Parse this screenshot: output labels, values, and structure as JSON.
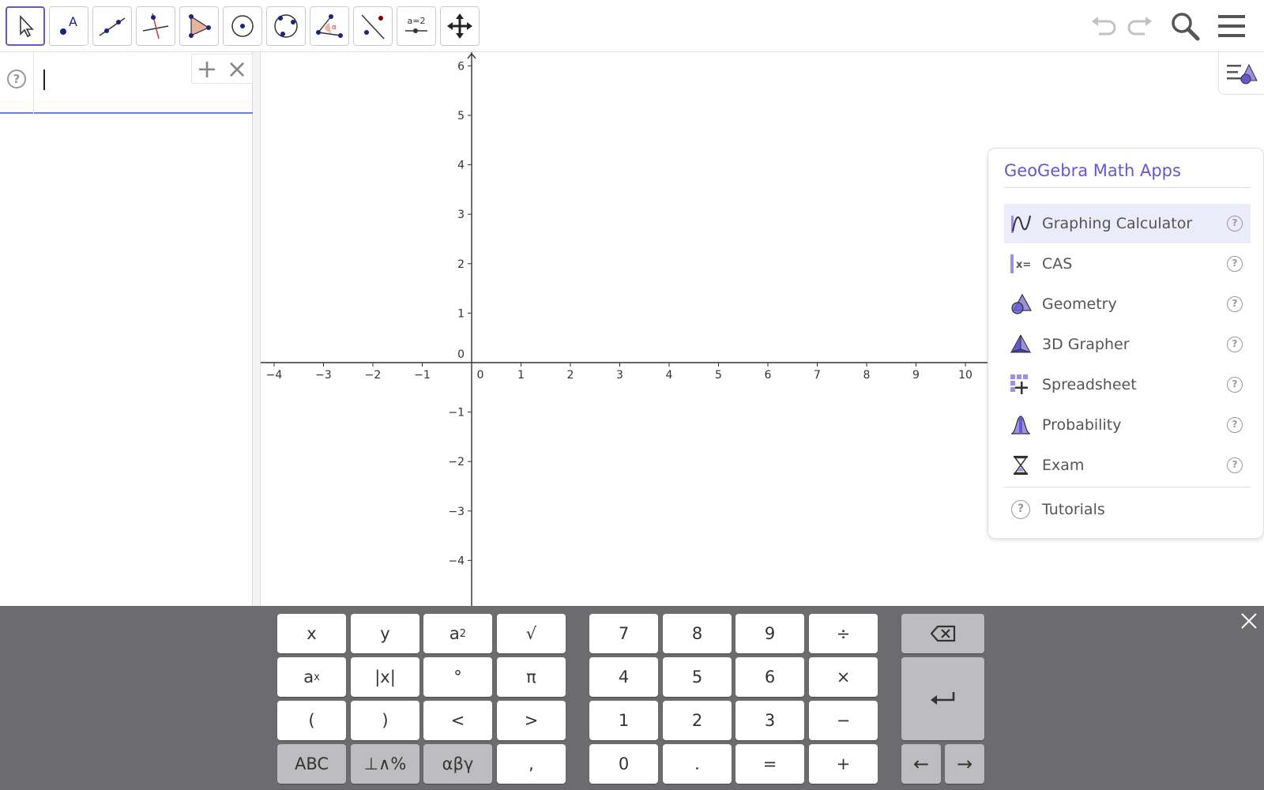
{
  "toolbar": {
    "tools": [
      {
        "name": "move-tool",
        "icon": "cursor-arrow-icon",
        "active": true
      },
      {
        "name": "point-tool",
        "icon": "point-a-icon"
      },
      {
        "name": "line-tool",
        "icon": "line-through-points-icon"
      },
      {
        "name": "perpendicular-line-tool",
        "icon": "perpendicular-line-icon"
      },
      {
        "name": "polygon-tool",
        "icon": "polygon-icon"
      },
      {
        "name": "circle-center-point-tool",
        "icon": "circle-center-icon"
      },
      {
        "name": "circle-three-points-tool",
        "icon": "circle-three-points-icon"
      },
      {
        "name": "angle-tool",
        "icon": "angle-icon"
      },
      {
        "name": "reflect-tool",
        "icon": "reflect-about-line-icon"
      },
      {
        "name": "slider-tool",
        "icon": "slider-icon",
        "label": "a=2"
      },
      {
        "name": "move-graphics-view-tool",
        "icon": "move-arrows-icon"
      }
    ],
    "right": [
      "undo-icon",
      "redo-icon",
      "search-icon",
      "menu-icon"
    ]
  },
  "algebra": {
    "help": "?",
    "input_value": "",
    "add_symbol": "+",
    "close_symbol": "×"
  },
  "graphics": {
    "x_ticks": [
      "−4",
      "−3",
      "−2",
      "−1",
      "0",
      "1",
      "2",
      "3",
      "4",
      "5",
      "6",
      "7",
      "8",
      "9",
      "10"
    ],
    "y_ticks": [
      "6",
      "5",
      "4",
      "3",
      "2",
      "1",
      "0",
      "−1",
      "−2",
      "−3",
      "−4"
    ],
    "origin_x": "0"
  },
  "apps_panel": {
    "title": "GeoGebra Math Apps",
    "apps": [
      {
        "label": "Graphing Calculator",
        "icon": "graphing-icon",
        "selected": true
      },
      {
        "label": "CAS",
        "icon": "cas-icon"
      },
      {
        "label": "Geometry",
        "icon": "geometry-icon"
      },
      {
        "label": "3D Grapher",
        "icon": "3d-grapher-icon"
      },
      {
        "label": "Spreadsheet",
        "icon": "spreadsheet-icon"
      },
      {
        "label": "Probability",
        "icon": "probability-icon"
      },
      {
        "label": "Exam",
        "icon": "hourglass-icon"
      }
    ],
    "tutorials": "Tutorials",
    "help": "?"
  },
  "keyboard": {
    "left": [
      [
        "x",
        "y",
        "a2",
        "√"
      ],
      [
        "ax",
        "|x|",
        "°",
        "π"
      ],
      [
        "(",
        ")",
        "<",
        ">"
      ],
      [
        "ABC",
        "⊥∧%",
        "αβγ",
        ","
      ]
    ],
    "numeric": [
      [
        "7",
        "8",
        "9",
        "÷"
      ],
      [
        "4",
        "5",
        "6",
        "×"
      ],
      [
        "1",
        "2",
        "3",
        "−"
      ],
      [
        "0",
        ".",
        "=",
        "+"
      ]
    ],
    "a_base": "a",
    "sup_2": "2",
    "sup_x": "x",
    "left_arrow": "←",
    "right_arrow": "→"
  },
  "colors": {
    "accent": "#6557d2",
    "keyboard_bg": "#6c6c6f",
    "key_gray": "#bdbdbf"
  }
}
